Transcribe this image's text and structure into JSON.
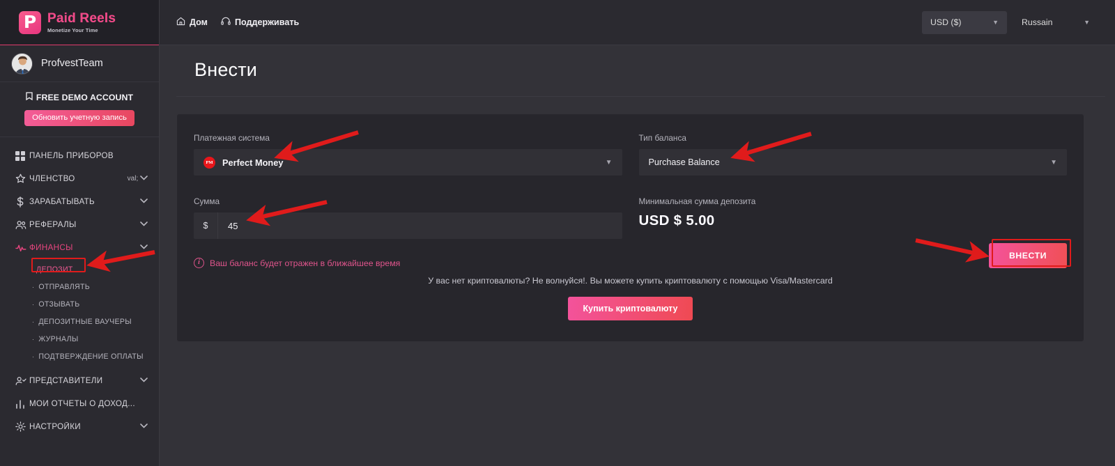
{
  "brand": {
    "logo_letter": "P",
    "title": "Paid Reels",
    "tagline": "Monetize Your Time"
  },
  "sidebar": {
    "user": {
      "name": "ProfvestTeam",
      "avatar_icon": "user-avatar"
    },
    "demo": {
      "badge_icon": "bookmark-icon",
      "label": "FREE DEMO ACCOUNT",
      "upgrade_button": "Обновить учетную запись"
    },
    "items": [
      {
        "label": "ПАНЕЛЬ ПРИБОРОВ",
        "icon": "dashboard-grid-icon",
        "chevron": false,
        "active": false
      },
      {
        "label": "ЧЛЕНСТВО",
        "icon": "star-icon",
        "chevron": true,
        "active": false
      },
      {
        "label": "ЗАРАБАТЫВАТЬ",
        "icon": "dollar-icon",
        "chevron": true,
        "active": false
      },
      {
        "label": "РЕФЕРАЛЫ",
        "icon": "users-icon",
        "chevron": true,
        "active": false
      },
      {
        "label": "ФИНАНСЫ",
        "icon": "pulse-icon",
        "chevron": true,
        "active": true
      }
    ],
    "finance_sub": [
      {
        "label": "ДЕПОЗИТ",
        "current": true
      },
      {
        "label": "ОТПРАВЛЯТЬ",
        "current": false
      },
      {
        "label": "ОТЗЫВАТЬ",
        "current": false
      },
      {
        "label": "ДЕПОЗИТНЫЕ ВАУЧЕРЫ",
        "current": false
      },
      {
        "label": "ЖУРНАЛЫ",
        "current": false
      },
      {
        "label": "ПОДТВЕРЖДЕНИЕ ОПЛАТЫ",
        "current": false
      }
    ],
    "items_bottom": [
      {
        "label": "ПРЕДСТАВИТЕЛИ",
        "icon": "user-check-icon",
        "chevron": true
      },
      {
        "label": "МОИ ОТЧЕТЫ О ДОХОД...",
        "icon": "bar-chart-icon",
        "chevron": false
      },
      {
        "label": "НАСТРОЙКИ",
        "icon": "gear-icon",
        "chevron": true
      }
    ]
  },
  "topbar": {
    "home_label": "Дом",
    "home_icon": "home-icon",
    "support_label": "Поддерживать",
    "support_icon": "headset-icon",
    "currency_selected": "USD ($)",
    "language_selected": "Russain"
  },
  "page": {
    "title": "Внести"
  },
  "form": {
    "payment_system_label": "Платежная система",
    "payment_system_value": "Perfect Money",
    "payment_system_badge": "PM",
    "balance_type_label": "Тип баланса",
    "balance_type_value": "Purchase Balance",
    "amount_label": "Сумма",
    "amount_prefix": "$",
    "amount_value": "45",
    "amount_placeholder": "",
    "min_deposit_label": "Минимальная сумма депозита",
    "min_deposit_value": "USD $ 5.00",
    "note_icon": "info-circle-icon",
    "note_text": "Ваш баланс будет отражен в ближайшее время",
    "crypto_line": "У вас нет криптовалюты? Не волнуйся!. Вы можете купить криптовалюту с помощью Visa/Mastercard",
    "crypto_button": "Купить криптовалюту",
    "submit_button": "ВНЕСТИ"
  },
  "colors": {
    "accent_pink": "#e8457f",
    "annotation_red": "#e01b1b",
    "page_bg": "#333238",
    "card_bg": "#27262c",
    "sidebar_bg": "#2b2a30"
  }
}
